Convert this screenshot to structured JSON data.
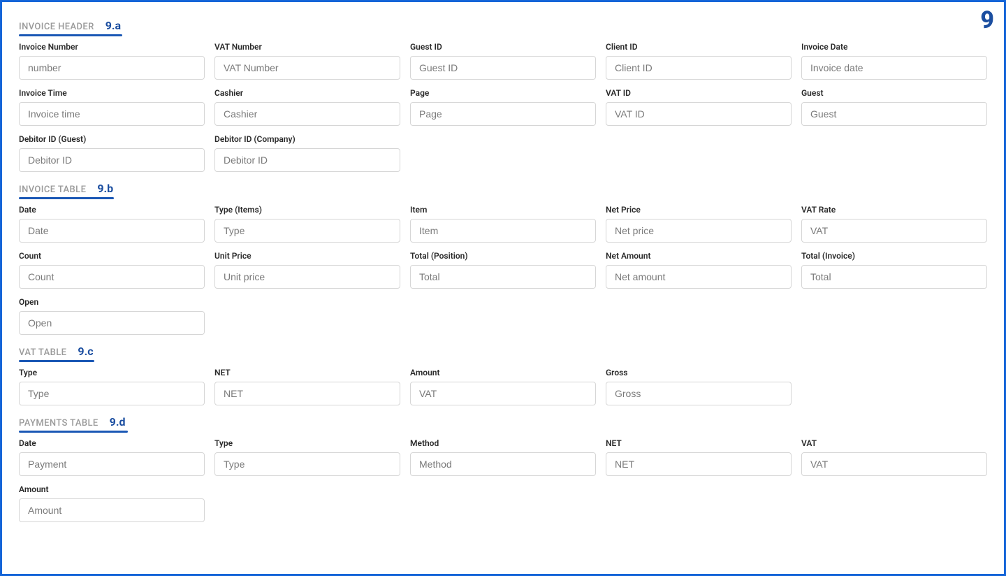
{
  "cornerBadge": "9",
  "sections": {
    "invoiceHeader": {
      "title": "INVOICE HEADER",
      "code": "9.a",
      "underlineWidth": 148,
      "fields": [
        {
          "label": "Invoice Number",
          "placeholder": "number"
        },
        {
          "label": "VAT Number",
          "placeholder": "VAT Number"
        },
        {
          "label": "Guest ID",
          "placeholder": "Guest ID"
        },
        {
          "label": "Client ID",
          "placeholder": "Client ID"
        },
        {
          "label": "Invoice Date",
          "placeholder": "Invoice date"
        },
        {
          "label": "Invoice Time",
          "placeholder": "Invoice time"
        },
        {
          "label": "Cashier",
          "placeholder": "Cashier"
        },
        {
          "label": "Page",
          "placeholder": "Page"
        },
        {
          "label": "VAT ID",
          "placeholder": "VAT ID"
        },
        {
          "label": "Guest",
          "placeholder": "Guest"
        },
        {
          "label": "Debitor ID (Guest)",
          "placeholder": "Debitor ID"
        },
        {
          "label": "Debitor ID (Company)",
          "placeholder": "Debitor ID"
        }
      ]
    },
    "invoiceTable": {
      "title": "INVOICE TABLE",
      "code": "9.b",
      "underlineWidth": 136,
      "fields": [
        {
          "label": "Date",
          "placeholder": "Date"
        },
        {
          "label": "Type (Items)",
          "placeholder": "Type"
        },
        {
          "label": "Item",
          "placeholder": "Item"
        },
        {
          "label": "Net Price",
          "placeholder": "Net price"
        },
        {
          "label": "VAT Rate",
          "placeholder": "VAT"
        },
        {
          "label": "Count",
          "placeholder": "Count"
        },
        {
          "label": "Unit Price",
          "placeholder": "Unit price"
        },
        {
          "label": "Total (Position)",
          "placeholder": "Total"
        },
        {
          "label": "Net Amount",
          "placeholder": "Net amount"
        },
        {
          "label": "Total (Invoice)",
          "placeholder": "Total"
        },
        {
          "label": "Open",
          "placeholder": "Open"
        }
      ]
    },
    "vatTable": {
      "title": "VAT TABLE",
      "code": "9.c",
      "underlineWidth": 108,
      "fields": [
        {
          "label": "Type",
          "placeholder": "Type"
        },
        {
          "label": "NET",
          "placeholder": "NET"
        },
        {
          "label": "Amount",
          "placeholder": "VAT"
        },
        {
          "label": "Gross",
          "placeholder": "Gross"
        }
      ]
    },
    "paymentsTable": {
      "title": "PAYMENTS TABLE",
      "code": "9.d",
      "underlineWidth": 156,
      "fields": [
        {
          "label": "Date",
          "placeholder": "Payment"
        },
        {
          "label": "Type",
          "placeholder": "Type"
        },
        {
          "label": "Method",
          "placeholder": "Method"
        },
        {
          "label": "NET",
          "placeholder": "NET"
        },
        {
          "label": "VAT",
          "placeholder": "VAT"
        },
        {
          "label": "Amount",
          "placeholder": "Amount"
        }
      ]
    }
  }
}
